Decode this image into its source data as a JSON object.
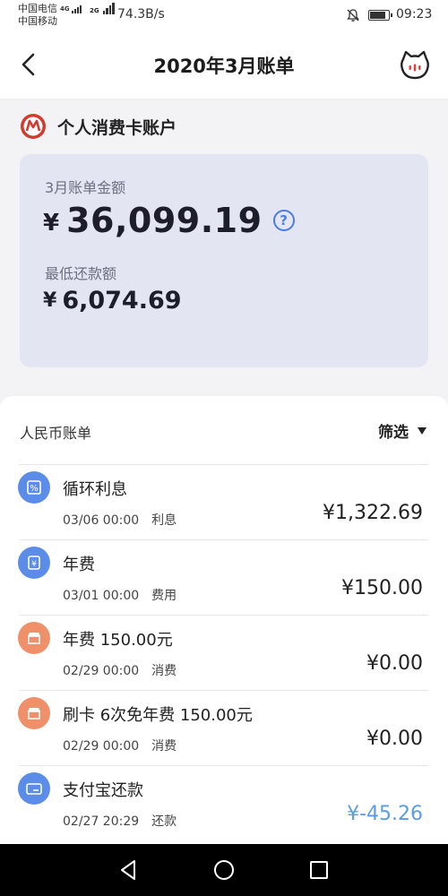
{
  "status_bar": {
    "carrier1": "中国电信",
    "carrier1_net": "4G",
    "carrier2": "中国移动",
    "carrier2_net": "2G",
    "speed": "74.3B/s",
    "time": "09:23",
    "battery_level": 0.9
  },
  "nav": {
    "title": "2020年3月账单",
    "back_icon": "chevron-left-icon",
    "service_icon": "cat-service-icon"
  },
  "account": {
    "name": "个人消费卡账户",
    "logo_icon": "bank-logo-icon"
  },
  "summary": {
    "bill_label": "3月账单金额",
    "currency": "¥",
    "bill_amount": "36,099.19",
    "help_glyph": "?",
    "min_label": "最低还款额",
    "min_amount": "6,074.69"
  },
  "transactions_section": {
    "title": "人民币账单",
    "filter_label": "筛选"
  },
  "transactions": [
    {
      "title": "循环利息",
      "date": "03/06 00:00",
      "category": "利息",
      "amount": "¥1,322.69",
      "icon": "percent-icon",
      "icon_color": "#5b8de8",
      "amount_color": "#222222"
    },
    {
      "title": "年费",
      "date": "03/01 00:00",
      "category": "费用",
      "amount": "¥150.00",
      "icon": "yuan-icon",
      "icon_color": "#5b8de8",
      "amount_color": "#222222"
    },
    {
      "title": "年费  150.00元",
      "date": "02/29 00:00",
      "category": "消费",
      "amount": "¥0.00",
      "icon": "shop-icon",
      "icon_color": "#f0906a",
      "amount_color": "#222222"
    },
    {
      "title": "刷卡  6次免年费  150.00元",
      "date": "02/29 00:00",
      "category": "消费",
      "amount": "¥0.00",
      "icon": "shop-icon",
      "icon_color": "#f0906a",
      "amount_color": "#222222"
    },
    {
      "title": "支付宝还款",
      "date": "02/27 20:29",
      "category": "还款",
      "amount": "¥-45.26",
      "icon": "card-icon",
      "icon_color": "#5b8de8",
      "amount_color": "#5b9be8"
    }
  ],
  "system_nav": {
    "back": "triangle-back-icon",
    "home": "circle-home-icon",
    "recent": "square-recent-icon"
  }
}
